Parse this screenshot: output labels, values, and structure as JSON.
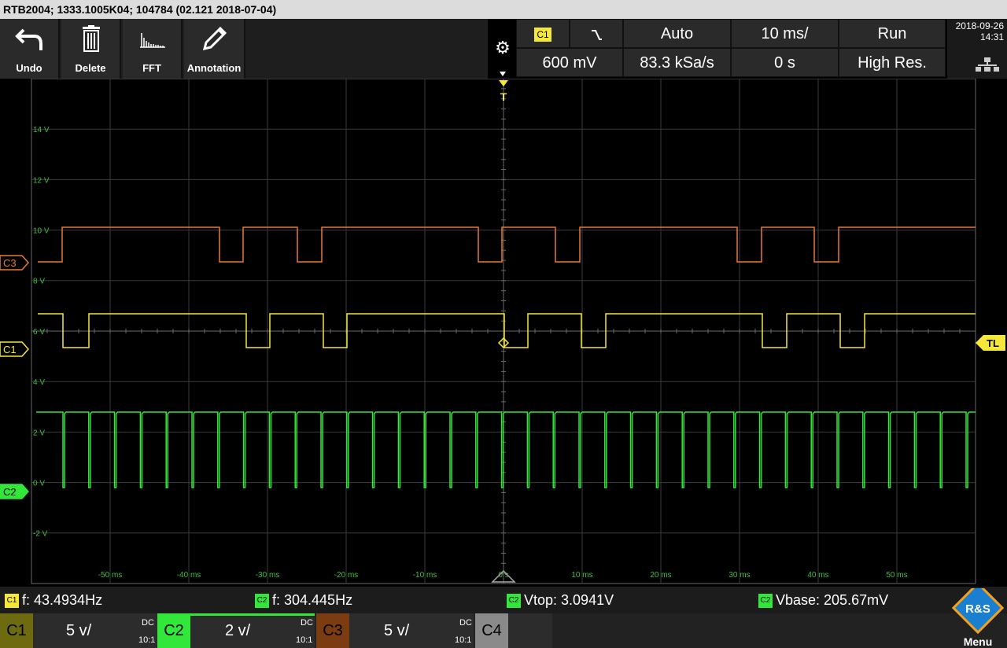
{
  "title": "RTB2004; 1333.1005K04; 104784 (02.121 2018-07-04)",
  "toolbar": {
    "undo": "Undo",
    "delete": "Delete",
    "fft": "FFT",
    "annotation": "Annotation"
  },
  "params": {
    "trig_source": "C1",
    "mode": "Auto",
    "timebase": "10 ms/",
    "run_state": "Run",
    "trig_level": "600 mV",
    "sample_rate": "83.3 kSa/s",
    "offset": "0 s",
    "acq_mode": "High Res."
  },
  "datetime": {
    "date": "2018-09-26",
    "time": "14:31"
  },
  "grid": {
    "volt_labels": [
      "14 V",
      "12 V",
      "10 V",
      "8 V",
      "6 V",
      "4 V",
      "2 V",
      "0 V",
      "-2 V"
    ],
    "time_labels": [
      "-50 ms",
      "-40 ms",
      "-30 ms",
      "-20 ms",
      "-10 ms",
      "0 s",
      "10 ms",
      "20 ms",
      "30 ms",
      "40 ms",
      "50 ms"
    ],
    "markers": {
      "c3": "C3",
      "c1": "C1",
      "c2": "C2",
      "tl": "TL",
      "t": "T"
    }
  },
  "colors": {
    "c1": "#f5e83a",
    "c2": "#33e63a",
    "c3": "#e87a30",
    "grid": "#3c3c3c",
    "grid_center": "#6a6a6a"
  },
  "measurements": [
    {
      "tag": "C1",
      "text": "f: 43.4934Hz"
    },
    {
      "tag": "C2",
      "text": "f: 304.445Hz"
    },
    {
      "tag": "C2",
      "text": "Vtop: 3.0941V"
    },
    {
      "tag": "C2",
      "text": "Vbase: 205.67mV"
    }
  ],
  "channels": [
    {
      "name": "C1",
      "scale": "5 v/",
      "coupling": "DC",
      "probe": "10:1"
    },
    {
      "name": "C2",
      "scale": "2 v/",
      "coupling": "DC",
      "probe": "10:1"
    },
    {
      "name": "C3",
      "scale": "5 v/",
      "coupling": "DC",
      "probe": "10:1"
    },
    {
      "name": "C4"
    }
  ],
  "menu": {
    "label": "Menu",
    "logo": "R&S"
  }
}
